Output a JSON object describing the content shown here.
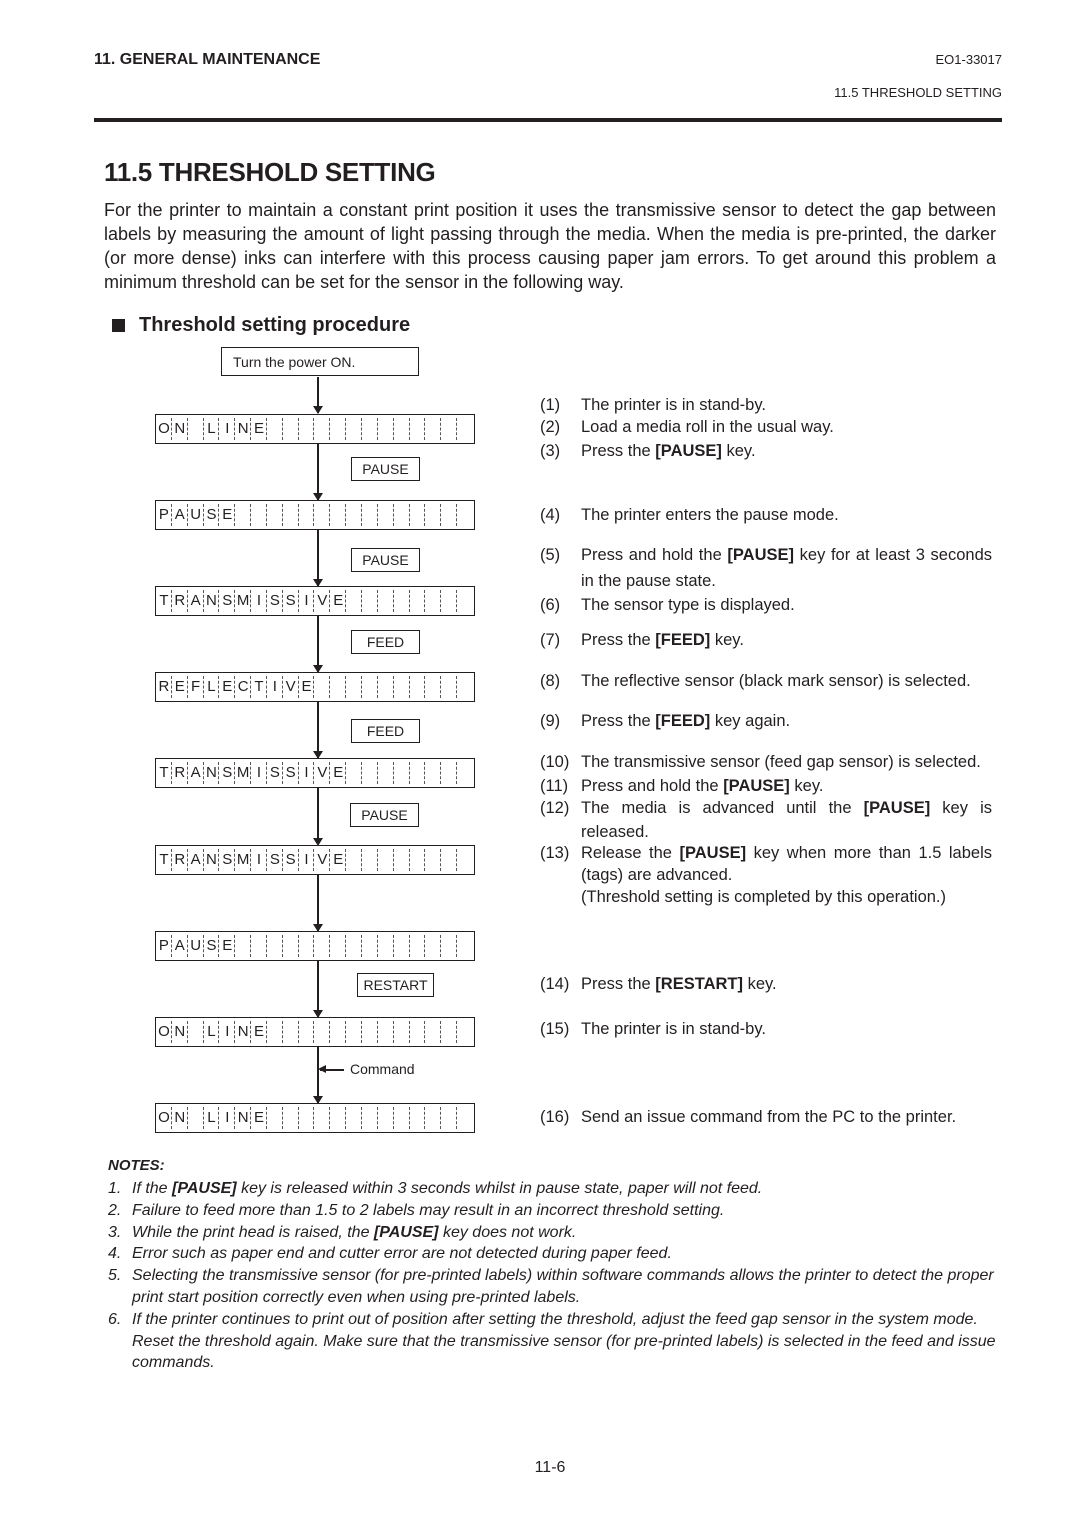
{
  "header": {
    "chapter": "11. GENERAL MAINTENANCE",
    "doc_code": "EO1-33017",
    "section_ref": "11.5 THRESHOLD SETTING"
  },
  "title": "11.5  THRESHOLD SETTING",
  "intro": "For the printer to maintain a constant print position it uses the transmissive sensor to detect the gap between labels by measuring the amount of light passing through the media.  When the media is pre-printed, the darker (or more dense) inks can interfere with this process causing paper jam errors.  To get around this problem a minimum threshold can be set for the sensor in the following way.",
  "subheading": "Threshold setting procedure",
  "flow": {
    "start": "Turn the power ON.",
    "lcd_displays": [
      "ON LINE",
      "PAUSE",
      "TRANSMISSIVE",
      "REFLECTIVE",
      "TRANSMISSIVE",
      "TRANSMISSIVE",
      "PAUSE",
      "ON LINE",
      "ON LINE"
    ],
    "keys": [
      "PAUSE",
      "PAUSE",
      "FEED",
      "FEED",
      "PAUSE",
      "RESTART"
    ],
    "command_label": "Command"
  },
  "steps": [
    {
      "num": "(1)",
      "pre": "The printer is in stand-by.",
      "key": "",
      "post": ""
    },
    {
      "num": "(2)",
      "pre": "Load a media roll in the usual way.",
      "key": "",
      "post": ""
    },
    {
      "num": "(3)",
      "pre": "Press the ",
      "key": "[PAUSE]",
      "post": " key."
    },
    {
      "num": "(4)",
      "pre": "The printer enters the pause mode.",
      "key": "",
      "post": ""
    },
    {
      "num": "(5)",
      "pre": "Press and hold the ",
      "key": "[PAUSE]",
      "post": " key for at least 3 seconds in the pause state."
    },
    {
      "num": "(6)",
      "pre": "The sensor type is displayed.",
      "key": "",
      "post": ""
    },
    {
      "num": "(7)",
      "pre": "Press the ",
      "key": "[FEED]",
      "post": " key."
    },
    {
      "num": "(8)",
      "pre": "The reflective sensor (black mark sensor) is selected.",
      "key": "",
      "post": ""
    },
    {
      "num": "(9)",
      "pre": "Press the ",
      "key": "[FEED]",
      "post": " key again."
    },
    {
      "num": "(10)",
      "pre": "The transmissive sensor (feed gap sensor) is selected.",
      "key": "",
      "post": ""
    },
    {
      "num": "(11)",
      "pre": "Press and hold the ",
      "key": "[PAUSE]",
      "post": " key."
    },
    {
      "num": "(12)",
      "pre": "The media is advanced until the ",
      "key": "[PAUSE]",
      "post": " key is released."
    },
    {
      "num": "(13)",
      "pre": "Release the ",
      "key": "[PAUSE]",
      "post": " key when more than 1.5 labels (tags) are advanced.\n(Threshold setting is completed by this operation.)"
    },
    {
      "num": "(14)",
      "pre": "Press the ",
      "key": "[RESTART]",
      "post": " key."
    },
    {
      "num": "(15)",
      "pre": "The printer is in stand-by.",
      "key": "",
      "post": ""
    },
    {
      "num": "(16)",
      "pre": "Send an issue command from the PC to the printer.",
      "key": "",
      "post": ""
    }
  ],
  "notes": {
    "title": "NOTES:",
    "items": [
      {
        "num": "1.",
        "pre": "If the ",
        "key": "[PAUSE]",
        "post": " key is released within 3 seconds whilst in pause state, paper will not feed."
      },
      {
        "num": "2.",
        "pre": "Failure to feed more than 1.5 to 2 labels may result in an incorrect threshold setting.",
        "key": "",
        "post": ""
      },
      {
        "num": "3.",
        "pre": "While the print head is raised, the ",
        "key": "[PAUSE]",
        "post": " key does not work."
      },
      {
        "num": "4.",
        "pre": "Error such as paper end and cutter error are not detected during paper feed.",
        "key": "",
        "post": ""
      },
      {
        "num": "5.",
        "pre": "Selecting the transmissive sensor (for pre-printed labels) within software commands allows the printer to detect the proper print start position correctly even when using pre-printed labels.",
        "key": "",
        "post": ""
      },
      {
        "num": "6.",
        "pre": "If the printer continues to print out of position after setting the threshold, adjust the feed gap sensor in the system mode.  Reset the threshold again.  Make sure that the transmissive sensor (for pre-printed labels) is selected in the feed and issue commands.",
        "key": "",
        "post": ""
      }
    ]
  },
  "page_number": "11-6"
}
